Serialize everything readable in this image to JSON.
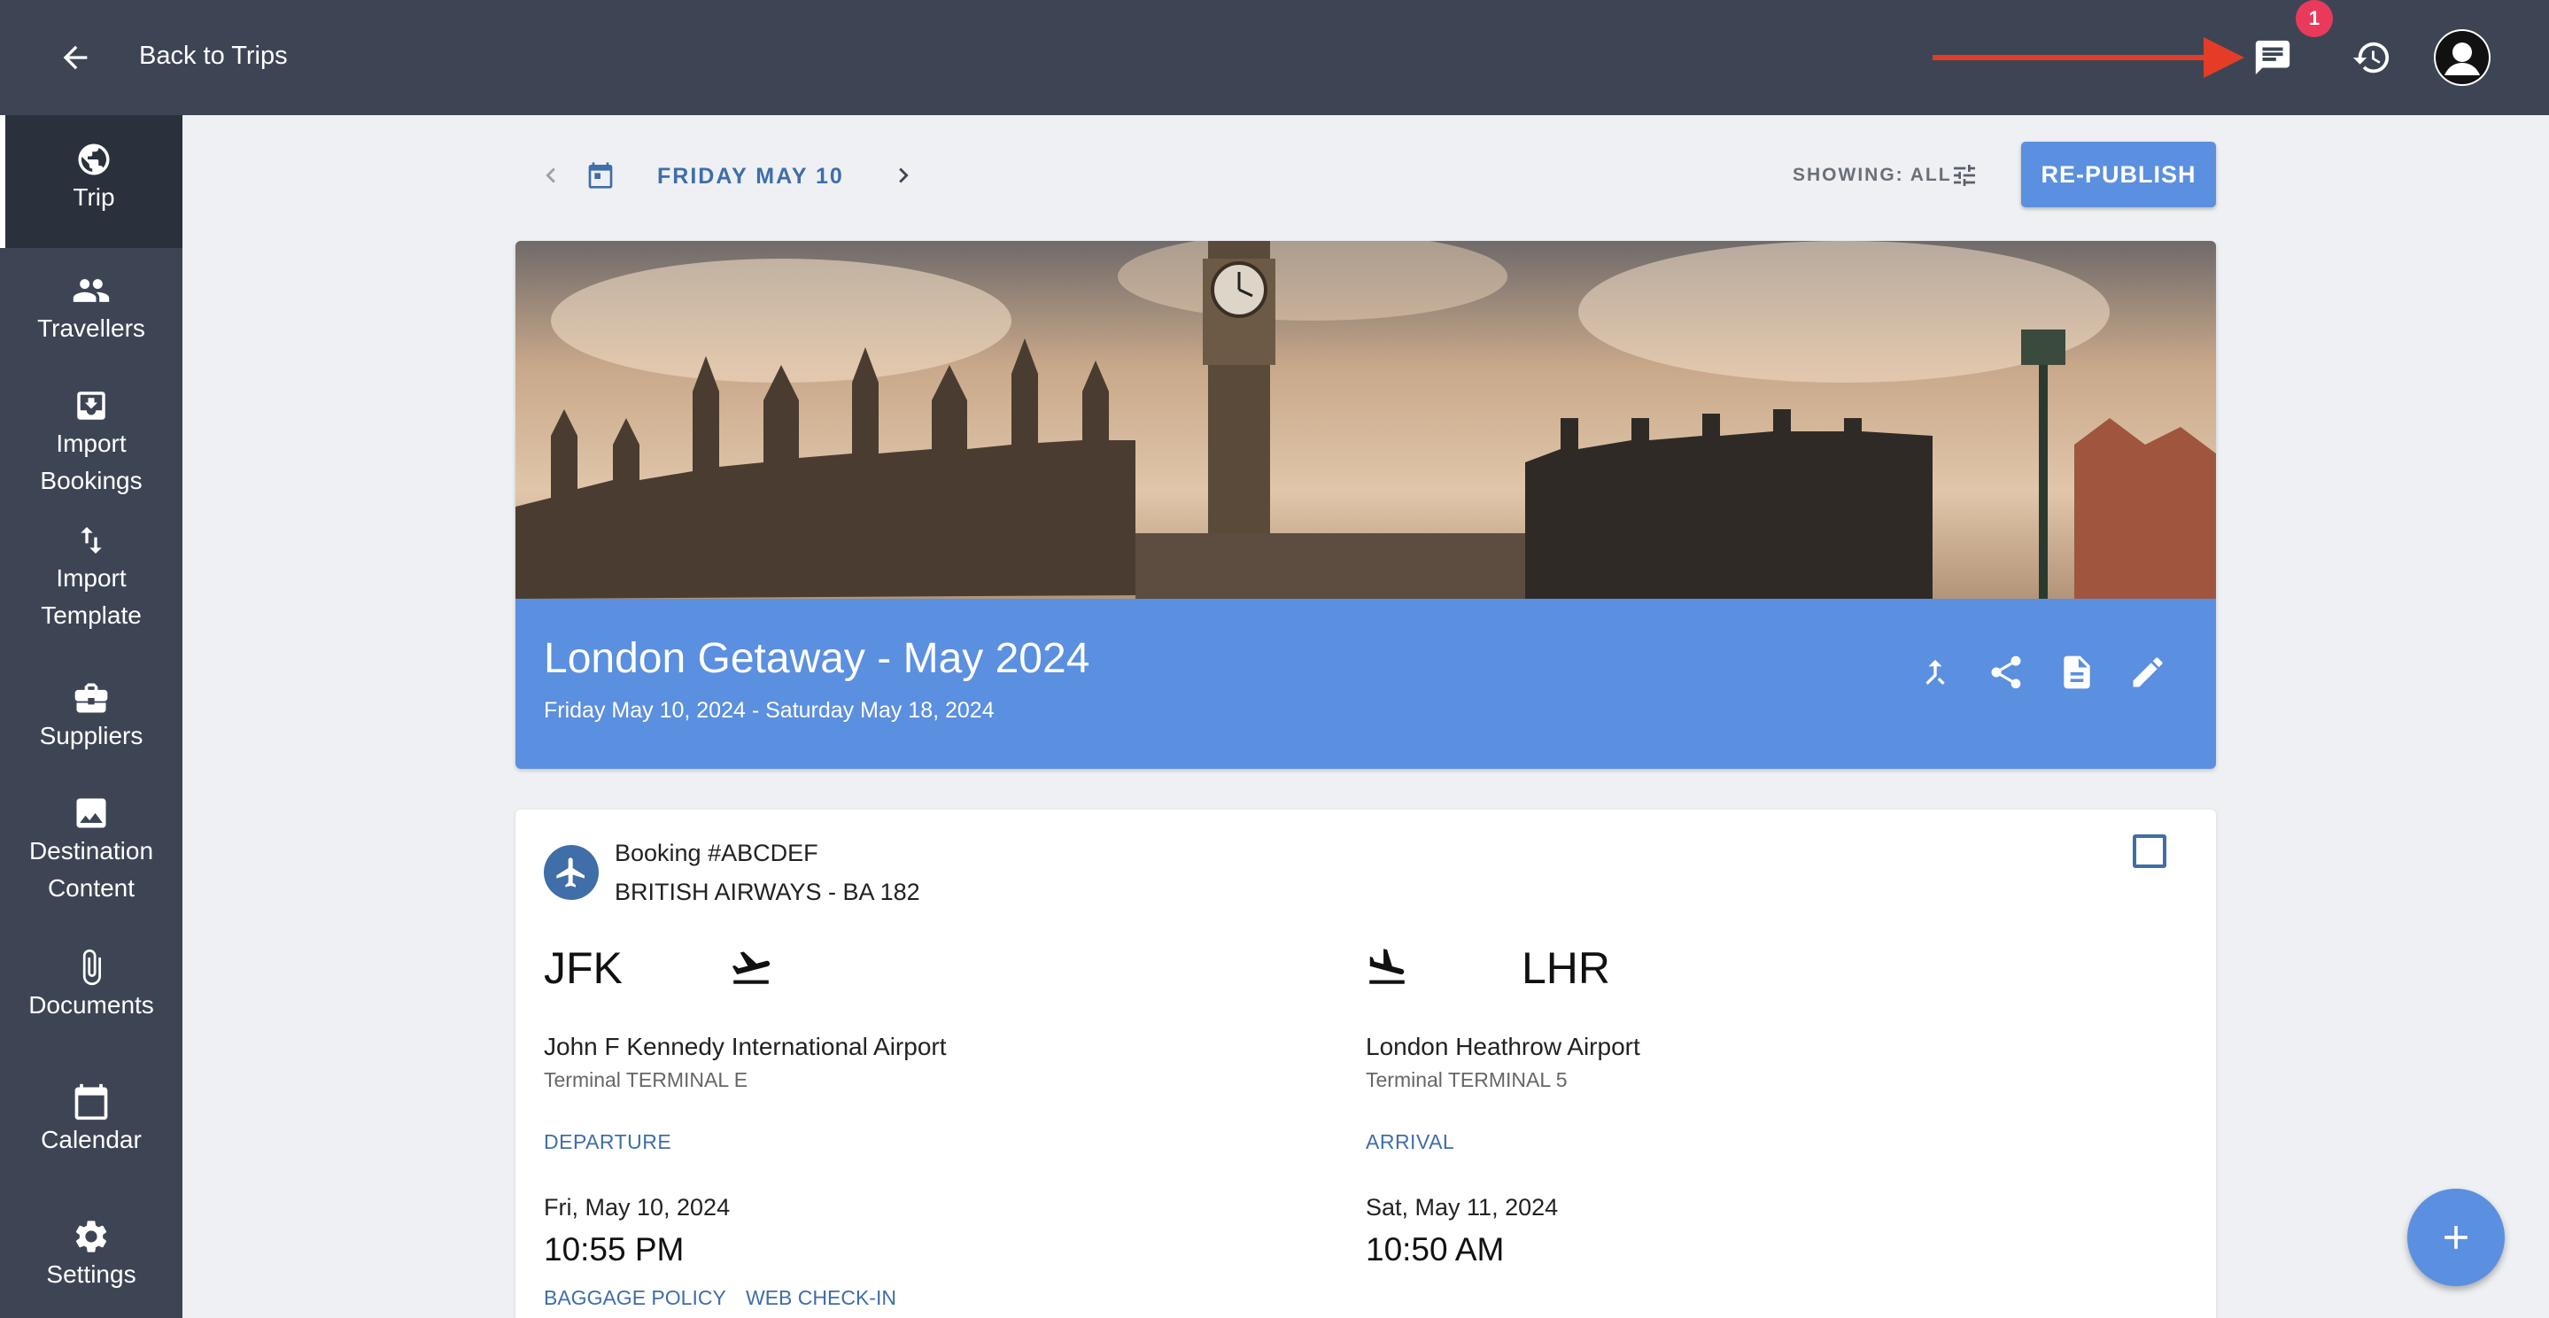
{
  "topbar": {
    "back_label": "Back to Trips",
    "messages_badge": "1",
    "icons": [
      "arrow-left-icon",
      "chat-icon",
      "history-icon",
      "user-avatar"
    ],
    "arrow_color": "#e53c27"
  },
  "sidebar": {
    "items": [
      {
        "label": "Trip",
        "icon": "globe-icon",
        "active": true
      },
      {
        "label": "Travellers",
        "icon": "people-icon"
      },
      {
        "label": "Import Bookings",
        "icon": "import-icon"
      },
      {
        "label": "Import Template",
        "icon": "swap-vertical-icon"
      },
      {
        "label": "Suppliers",
        "icon": "briefcase-icon"
      },
      {
        "label": "Destination Content",
        "icon": "image-icon"
      },
      {
        "label": "Documents",
        "icon": "paperclip-icon"
      },
      {
        "label": "Calendar",
        "icon": "calendar-icon"
      },
      {
        "label": "Settings",
        "icon": "gear-icon"
      }
    ]
  },
  "datebar": {
    "date": "FRIDAY MAY 10",
    "showing": "SHOWING: ALL",
    "republish": "RE-PUBLISH"
  },
  "trip": {
    "title": "London Getaway - May 2024",
    "dates": "Friday May 10, 2024 - Saturday May 18, 2024",
    "actions": [
      "merge-icon",
      "share-icon",
      "document-icon",
      "edit-icon"
    ]
  },
  "booking": {
    "number": "Booking #ABCDEF",
    "airline": "BRITISH AIRWAYS - BA 182",
    "departure": {
      "code": "JFK",
      "airport": "John F Kennedy International Airport",
      "terminal": "Terminal TERMINAL E",
      "kind": "DEPARTURE",
      "day": "Fri, May 10, 2024",
      "time": "10:55 PM"
    },
    "arrival": {
      "code": "LHR",
      "airport": "London Heathrow Airport",
      "terminal": "Terminal TERMINAL 5",
      "kind": "ARRIVAL",
      "day": "Sat, May 11, 2024",
      "time": "10:50 AM"
    },
    "links": {
      "baggage": "BAGGAGE POLICY",
      "checkin": "WEB CHECK-IN"
    }
  },
  "colors": {
    "nav_bg": "#3d4555",
    "accent": "#5b8fdf",
    "link": "#3f6ea8",
    "badge": "#ea3a5c"
  }
}
